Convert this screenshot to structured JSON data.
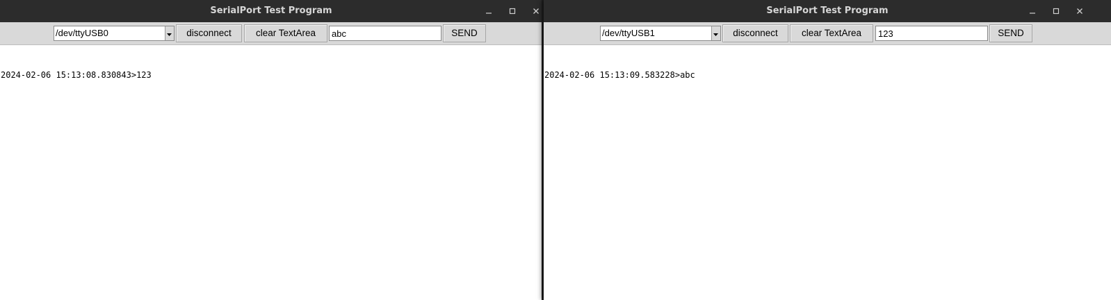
{
  "windows": [
    {
      "title": "SerialPort Test Program",
      "port": "/dev/ttyUSB0",
      "disconnect_label": "disconnect",
      "clear_label": "clear TextArea",
      "send_value": "abc",
      "send_label": "SEND",
      "log": "2024-02-06 15:13:08.830843>123"
    },
    {
      "title": "SerialPort Test Program",
      "port": "/dev/ttyUSB1",
      "disconnect_label": "disconnect",
      "clear_label": "clear TextArea",
      "send_value": "123",
      "send_label": "SEND",
      "log": "2024-02-06 15:13:09.583228>abc"
    }
  ],
  "icons": {
    "minimize": "minimize-icon",
    "maximize": "maximize-icon",
    "close": "close-icon",
    "dropdown": "chevron-down-icon"
  },
  "colors": {
    "titlebar": "#2c2c2c",
    "toolbar": "#d9d9d9",
    "title_text": "#d6d6d6"
  }
}
